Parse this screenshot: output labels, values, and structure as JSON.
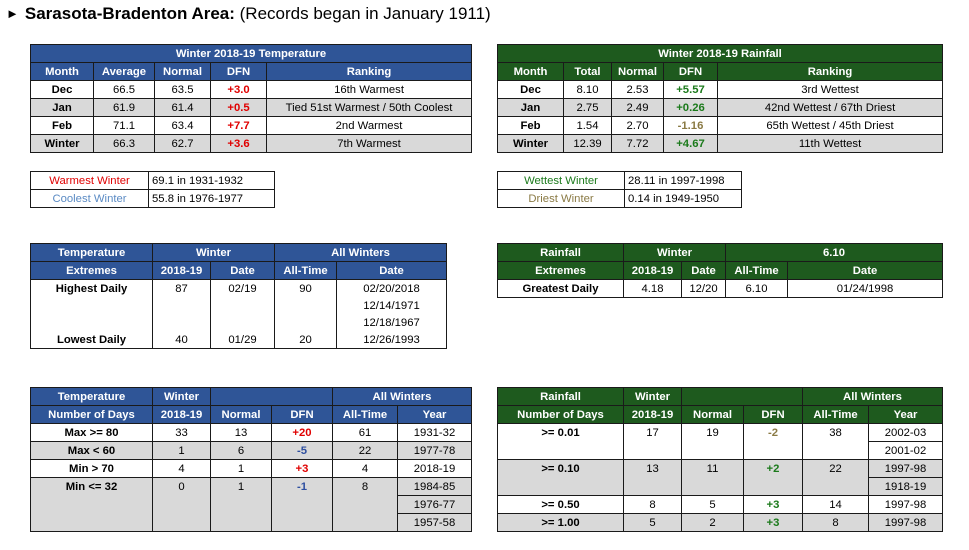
{
  "title": {
    "arrow": "►",
    "bold": "Sarasota-Bradenton Area:",
    "rest": " (Records began in January 1911)"
  },
  "temp": {
    "title": "Winter 2018-19 Temperature",
    "headers": [
      "Month",
      "Average",
      "Normal",
      "DFN",
      "Ranking"
    ],
    "rows": [
      {
        "m": "Dec",
        "avg": "66.5",
        "norm": "63.5",
        "dfn": "+3.0",
        "rank": "16th Warmest"
      },
      {
        "m": "Jan",
        "avg": "61.9",
        "norm": "61.4",
        "dfn": "+0.5",
        "rank": "Tied 51st Warmest / 50th Coolest"
      },
      {
        "m": "Feb",
        "avg": "71.1",
        "norm": "63.4",
        "dfn": "+7.7",
        "rank": "2nd Warmest"
      },
      {
        "m": "Winter",
        "avg": "66.3",
        "norm": "62.7",
        "dfn": "+3.6",
        "rank": "7th Warmest"
      }
    ]
  },
  "rain": {
    "title": "Winter 2018-19 Rainfall",
    "headers": [
      "Month",
      "Total",
      "Normal",
      "DFN",
      "Ranking"
    ],
    "rows": [
      {
        "m": "Dec",
        "tot": "8.10",
        "norm": "2.53",
        "dfn": "+5.57",
        "rank": "3rd Wettest"
      },
      {
        "m": "Jan",
        "tot": "2.75",
        "norm": "2.49",
        "dfn": "+0.26",
        "rank": "42nd Wettest / 67th Driest"
      },
      {
        "m": "Feb",
        "tot": "1.54",
        "norm": "2.70",
        "dfn": "-1.16",
        "rank": "65th Wettest / 45th Driest"
      },
      {
        "m": "Winter",
        "tot": "12.39",
        "norm": "7.72",
        "dfn": "+4.67",
        "rank": "11th Wettest"
      }
    ]
  },
  "temp_records": {
    "warm_label": "Warmest Winter",
    "warm_val": "69.1 in 1931-1932",
    "cool_label": "Coolest Winter",
    "cool_val": "55.8 in 1976-1977"
  },
  "rain_records": {
    "wet_label": "Wettest Winter",
    "wet_val": "28.11 in 1997-1998",
    "dry_label": "Driest Winter",
    "dry_val": "0.14 in 1949-1950"
  },
  "temp_ext": {
    "h1": "Temperature",
    "h2": "Extremes",
    "winter": "Winter",
    "all": "All Winters",
    "sub": [
      "2018-19",
      "Date",
      "All-Time",
      "Date"
    ],
    "high_label": "Highest Daily",
    "high_val": "87",
    "high_date": "02/19",
    "high_all": "90",
    "high_dates": [
      "02/20/2018",
      "12/14/1971",
      "12/18/1967"
    ],
    "low_label": "Lowest Daily",
    "low_val": "40",
    "low_date": "01/29",
    "low_all": "20",
    "low_alldate": "12/26/1993"
  },
  "rain_ext": {
    "h1": "Rainfall",
    "h2": "Extremes",
    "winter": "Winter",
    "all": "6.10",
    "sub": [
      "2018-19",
      "Date",
      "All-Time",
      "Date"
    ],
    "label": "Greatest Daily",
    "val": "4.18",
    "date": "12/20",
    "alldate": "01/24/1998"
  },
  "temp_days": {
    "h1": "Temperature",
    "h2": "Number of Days",
    "winter": "Winter",
    "all": "All Winters",
    "sub": [
      "2018-19",
      "Normal",
      "DFN",
      "All-Time",
      "Year"
    ],
    "rows": [
      {
        "l": "Max >= 80",
        "v": "33",
        "n": "13",
        "d": "+20",
        "a": "61",
        "y": "1931-32"
      },
      {
        "l": "Max < 60",
        "v": "1",
        "n": "6",
        "d": "-5",
        "a": "22",
        "y": "1977-78"
      },
      {
        "l": "Min > 70",
        "v": "4",
        "n": "1",
        "d": "+3",
        "a": "4",
        "y": "2018-19"
      },
      {
        "l": "Min <= 32",
        "v": "0",
        "n": "1",
        "d": "-1",
        "a": "8",
        "y": "1984-85"
      }
    ],
    "extra_years": [
      "1976-77",
      "1957-58"
    ]
  },
  "rain_days": {
    "h1": "Rainfall",
    "h2": "Number of Days",
    "winter": "Winter",
    "all": "All Winters",
    "sub": [
      "2018-19",
      "Normal",
      "DFN",
      "All-Time",
      "Year"
    ],
    "r1": {
      "l": ">= 0.01",
      "v": "17",
      "n": "19",
      "d": "-2",
      "a": "38",
      "y": "2002-03",
      "y2": "2001-02"
    },
    "r2": {
      "l": ">= 0.10",
      "v": "13",
      "n": "11",
      "d": "+2",
      "a": "22",
      "y": "1997-98",
      "y2": "1918-19"
    },
    "r3": {
      "l": ">= 0.50",
      "v": "8",
      "n": "5",
      "d": "+3",
      "a": "14",
      "y": "1997-98"
    },
    "r4": {
      "l": ">= 1.00",
      "v": "5",
      "n": "2",
      "d": "+3",
      "a": "8",
      "y": "1997-98"
    }
  }
}
